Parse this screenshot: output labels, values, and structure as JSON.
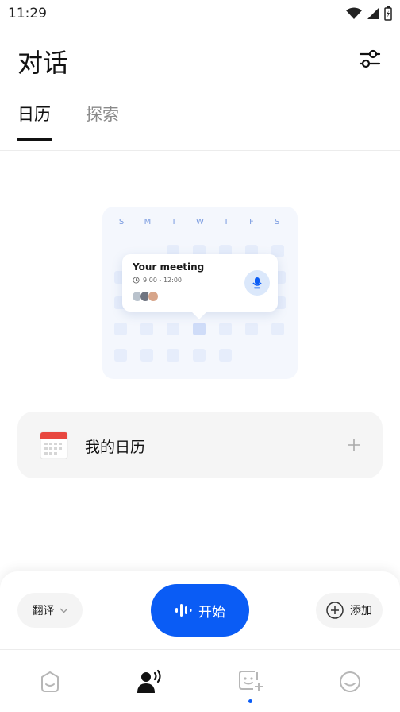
{
  "status_bar": {
    "time": "11:29"
  },
  "header": {
    "title": "对话"
  },
  "tabs": [
    {
      "label": "日历"
    },
    {
      "label": "探索"
    }
  ],
  "illustration": {
    "weekdays": [
      "S",
      "M",
      "T",
      "W",
      "T",
      "F",
      "S"
    ],
    "meeting_title": "Your meeting",
    "meeting_time": "9:00 - 12:00"
  },
  "my_calendar": {
    "label": "我的日历"
  },
  "controls": {
    "translate_label": "翻译",
    "start_label": "开始",
    "add_label": "添加"
  },
  "colors": {
    "accent": "#0a5cf5",
    "calendar_red": "#e8473f"
  },
  "nav": {
    "items": [
      "smile-face-icon",
      "voice-person-icon",
      "add-sticker-icon",
      "emoji-icon"
    ]
  }
}
